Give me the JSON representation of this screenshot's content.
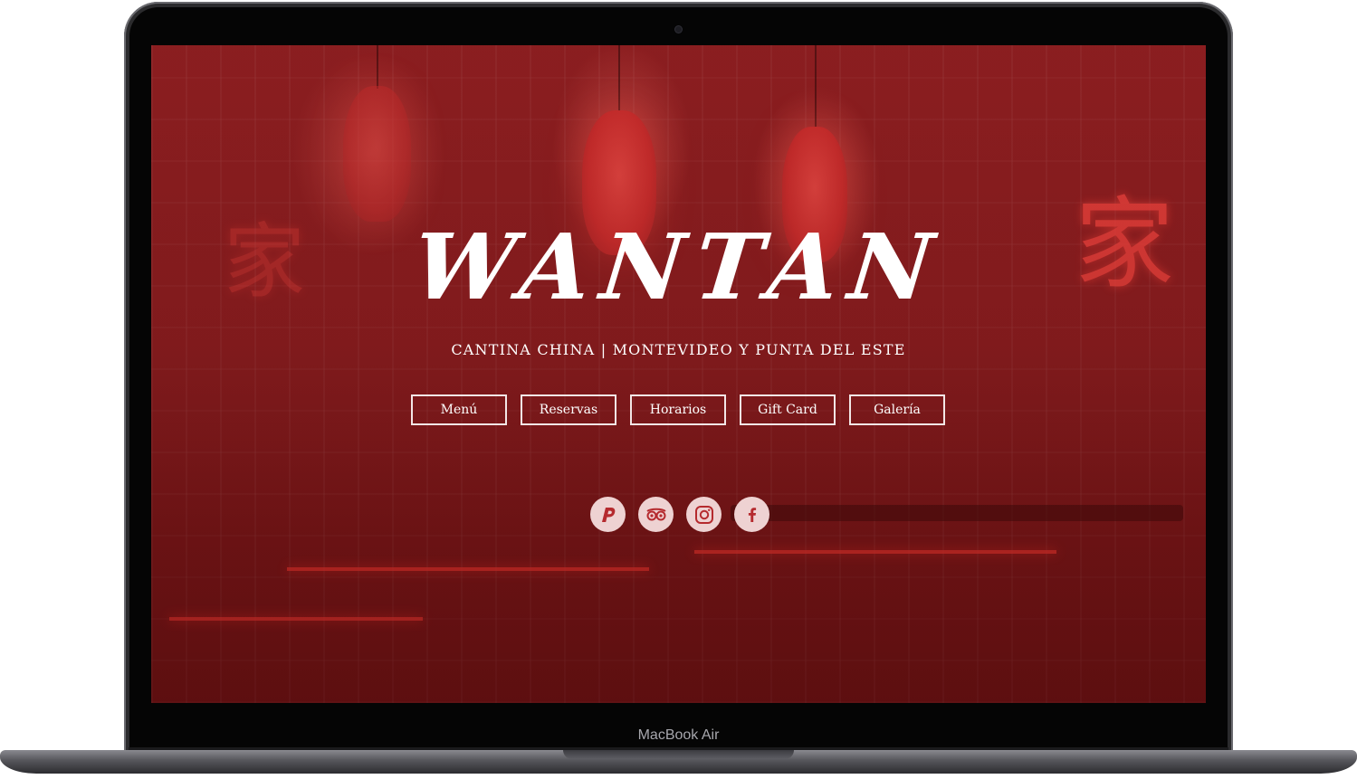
{
  "device": {
    "model_label": "MacBook Air"
  },
  "site": {
    "logo_text": "WANTAN",
    "tagline": "CANTINA CHINA | MONTEVIDEO Y PUNTA DEL ESTE",
    "nav": [
      {
        "label": "Menú"
      },
      {
        "label": "Reservas"
      },
      {
        "label": "Horarios"
      },
      {
        "label": "Gift Card"
      },
      {
        "label": "Galería"
      }
    ],
    "social": [
      {
        "icon": "pedidosya-icon"
      },
      {
        "icon": "tripadvisor-icon"
      },
      {
        "icon": "instagram-icon"
      },
      {
        "icon": "facebook-icon"
      }
    ],
    "colors": {
      "background_red": "#8e2022",
      "social_circle": "#eed2d2",
      "social_icon": "#b52a2e",
      "text": "#ffffff"
    }
  }
}
